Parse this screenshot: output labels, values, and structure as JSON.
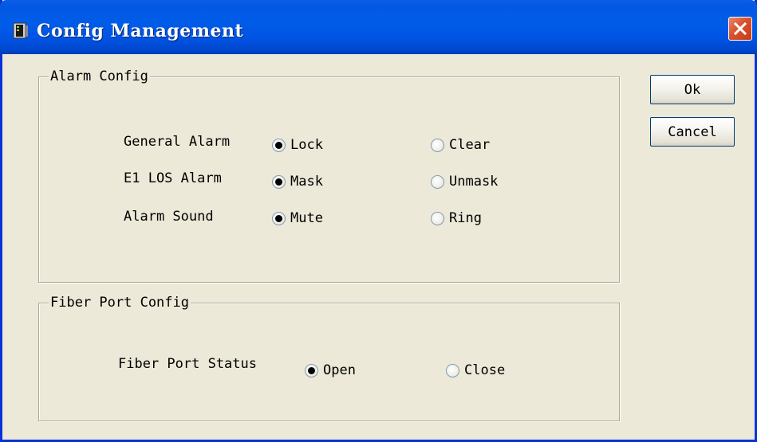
{
  "window": {
    "title": "Config Management",
    "close_icon": "close-icon"
  },
  "buttons": {
    "ok_label": "Ok",
    "cancel_label": "Cancel"
  },
  "alarm_config": {
    "legend": "Alarm Config",
    "rows": [
      {
        "label": "General Alarm",
        "options": [
          "Lock",
          "Clear"
        ],
        "selected": "Lock"
      },
      {
        "label": "E1 LOS Alarm",
        "options": [
          "Mask",
          "Unmask"
        ],
        "selected": "Mask"
      },
      {
        "label": "Alarm Sound",
        "options": [
          "Mute",
          "Ring"
        ],
        "selected": "Mute"
      }
    ]
  },
  "fiber_port_config": {
    "legend": "Fiber Port Config",
    "rows": [
      {
        "label": "Fiber Port Status",
        "options": [
          "Open",
          "Close"
        ],
        "selected": "Open"
      }
    ]
  },
  "colors": {
    "titlebar": "#0054e3",
    "dialog_bg": "#ece9d8",
    "close_button": "#d8522d"
  }
}
